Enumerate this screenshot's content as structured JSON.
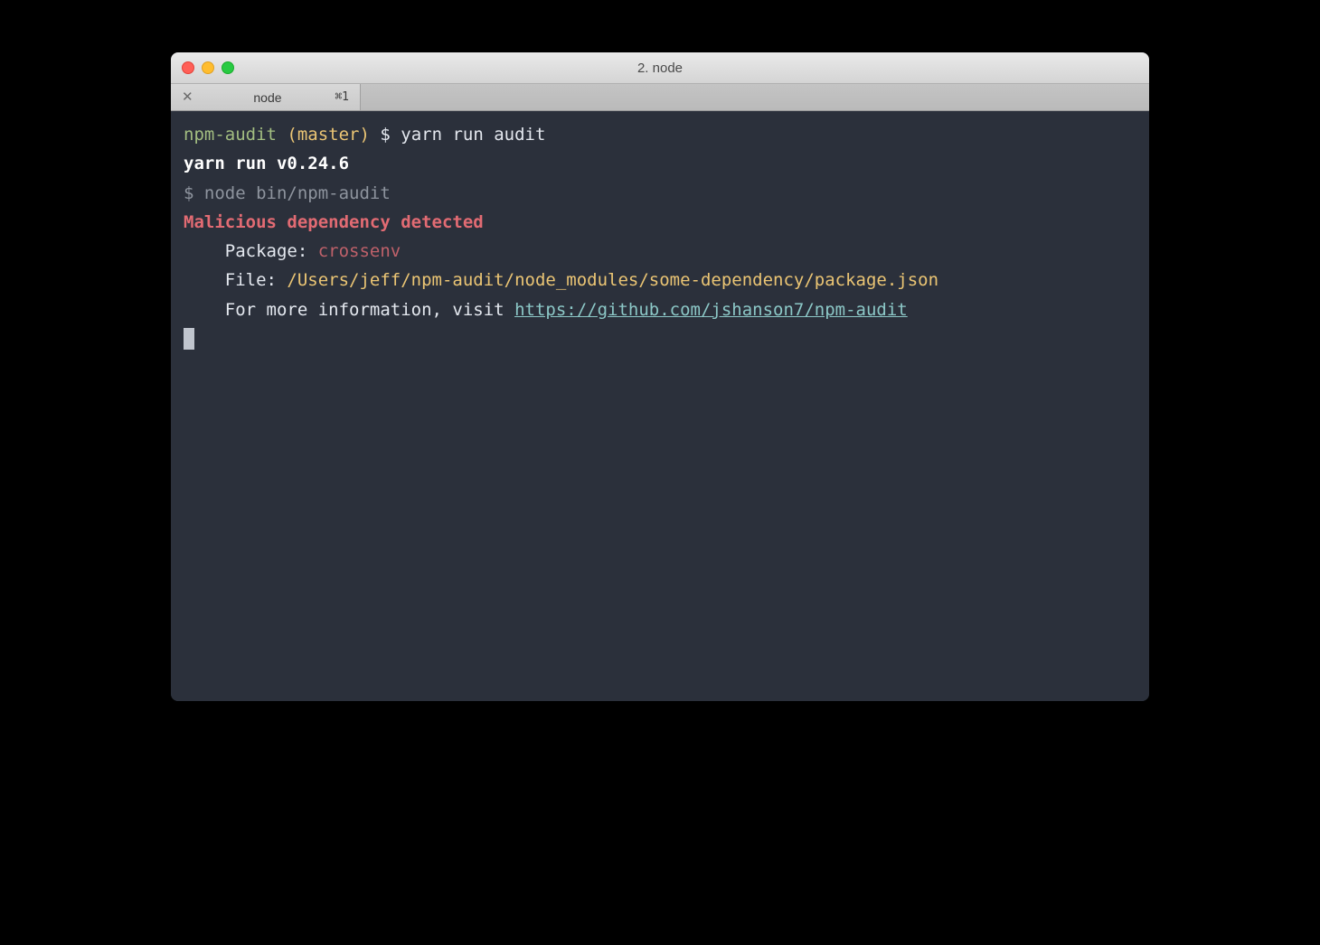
{
  "window": {
    "title": "2. node"
  },
  "tab": {
    "label": "node",
    "shortcut": "⌘1",
    "close": "✕"
  },
  "terminal": {
    "line1": {
      "repo": "npm-audit",
      "branch": "(master)",
      "prompt": "$",
      "command": "yarn run audit"
    },
    "line2": "yarn run v0.24.6",
    "line3": {
      "prefix": "$",
      "cmd": "node bin/npm-audit"
    },
    "line4": "Malicious dependency detected",
    "line5": {
      "indent": "    ",
      "label": "Package: ",
      "value": "crossenv"
    },
    "line6": {
      "indent": "    ",
      "label": "File: ",
      "value": "/Users/jeff/npm-audit/node_modules/some-dependency/package.json"
    },
    "line7": {
      "indent": "    ",
      "label": "For more information, visit ",
      "url": "https://github.com/jshanson7/npm-audit"
    }
  }
}
